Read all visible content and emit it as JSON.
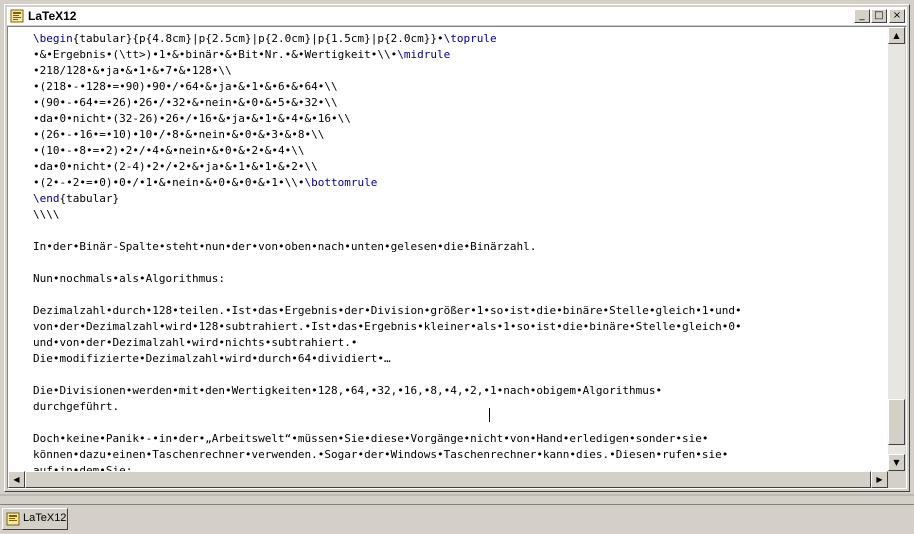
{
  "window": {
    "title": "LaTeX12",
    "buttons": {
      "minimize": "_",
      "maximize": "□",
      "close": "×"
    }
  },
  "editor": {
    "lines": [
      [
        {
          "t": "\\begin",
          "k": 1
        },
        {
          "t": "{tabular}{p{4.8cm}|p{2.5cm}|p{2.0cm}|p{1.5cm}|p{2.0cm}}•"
        },
        {
          "t": "\\toprule",
          "k": 1
        }
      ],
      [
        {
          "t": "•&•Ergebnis•(\\tt>)•1•&•binär•&•Bit•Nr.•&•Wertigkeit•\\\\•"
        },
        {
          "t": "\\midrule",
          "k": 1
        }
      ],
      [
        {
          "t": "•218/128•&•ja•&•1•&•7•&•128•\\\\"
        }
      ],
      [
        {
          "t": "•(218•-•128•=•90)•90•/•64•&•ja•&•1•&•6•&•64•\\\\"
        }
      ],
      [
        {
          "t": "•(90•-•64•=•26)•26•/•32•&•nein•&•0•&•5•&•32•\\\\"
        }
      ],
      [
        {
          "t": "•da•0•nicht•(32-26)•26•/•16•&•ja•&•1•&•4•&•16•\\\\"
        }
      ],
      [
        {
          "t": "•(26•-•16•=•10)•10•/•8•&•nein•&•0•&•3•&•8•\\\\"
        }
      ],
      [
        {
          "t": "•(10•-•8•=•2)•2•/•4•&•nein•&•0•&•2•&•4•\\\\"
        }
      ],
      [
        {
          "t": "•da•0•nicht•(2-4)•2•/•2•&•ja•&•1•&•1•&•2•\\\\"
        }
      ],
      [
        {
          "t": "•(2•-•2•=•0)•0•/•1•&•nein•&•0•&•0•&•1•\\\\•"
        },
        {
          "t": "\\bottomrule",
          "k": 1
        }
      ],
      [
        {
          "t": "\\end",
          "k": 1
        },
        {
          "t": "{tabular}"
        }
      ],
      [
        {
          "t": "\\\\\\\\"
        }
      ],
      [
        {
          "t": ""
        }
      ],
      [
        {
          "t": "In•der•Binär-Spalte•steht•nun•der•von•oben•nach•unten•gelesen•die•Binärzahl."
        }
      ],
      [
        {
          "t": ""
        }
      ],
      [
        {
          "t": "Nun•nochmals•als•Algorithmus:"
        }
      ],
      [
        {
          "t": ""
        }
      ],
      [
        {
          "t": "Dezimalzahl•durch•128•teilen.•Ist•das•Ergebnis•der•Division•größer•1•so•ist•die•binäre•Stelle•gleich•1•und•"
        }
      ],
      [
        {
          "t": "von•der•Dezimalzahl•wird•128•subtrahiert.•Ist•das•Ergebnis•kleiner•als•1•so•ist•die•binäre•Stelle•gleich•0•"
        }
      ],
      [
        {
          "t": "und•von•der•Dezimalzahl•wird•nichts•subtrahiert.•"
        }
      ],
      [
        {
          "t": "Die•modifizierte•Dezimalzahl•wird•durch•64•dividiert•…"
        }
      ],
      [
        {
          "t": ""
        }
      ],
      [
        {
          "t": "Die•Divisionen•werden•mit•den•Wertigkeiten•128,•64,•32,•16,•8,•4,•2,•1•nach•obigem•Algorithmus•"
        }
      ],
      [
        {
          "t": "durchgeführt."
        }
      ],
      [
        {
          "t": ""
        }
      ],
      [
        {
          "t": "Doch•keine•Panik•-•in•der•„Arbeitswelt“•müssen•Sie•diese•Vorgänge•nicht•von•Hand•erledigen•sonder•sie•"
        }
      ],
      [
        {
          "t": "können•dazu•einen•Taschenrechner•verwenden.•Sogar•der•Windows•Taschenrechner•kann•dies.•Diesen•rufen•sie•"
        }
      ],
      [
        {
          "t": "auf•in•dem•Sie:"
        }
      ]
    ]
  },
  "taskbar": {
    "tabs": [
      {
        "label": "LaTeX12"
      }
    ]
  },
  "scrollbars": {
    "up_arrow": "▲",
    "down_arrow": "▼",
    "left_arrow": "◀",
    "right_arrow": "▶"
  }
}
